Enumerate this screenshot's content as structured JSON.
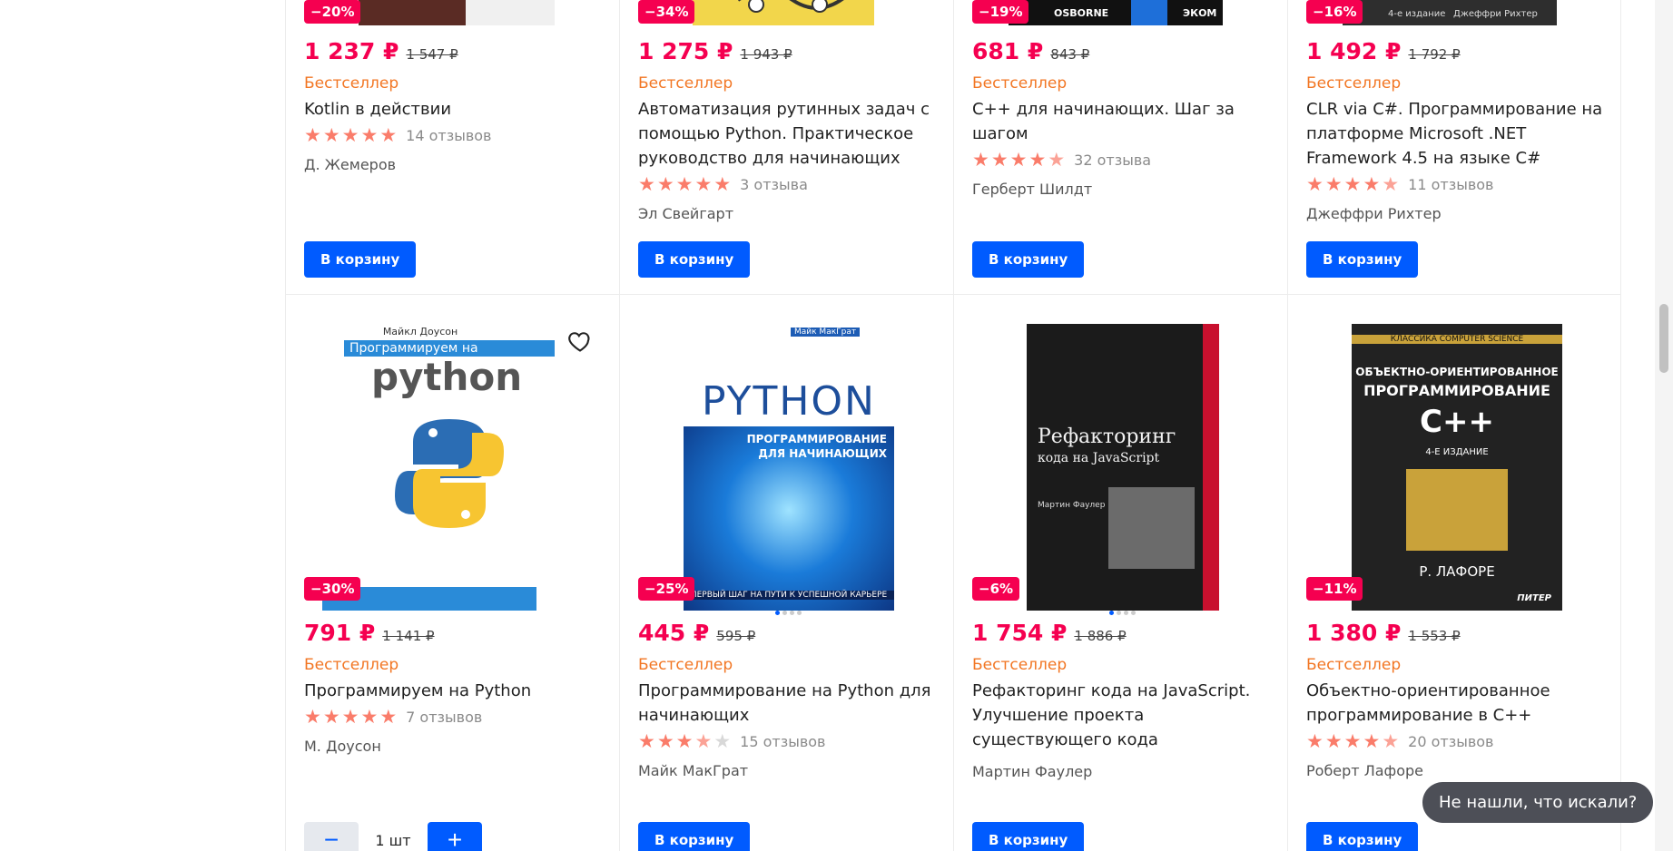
{
  "currency": "₽",
  "bestseller_label": "Бестселлер",
  "cart_label": "В корзину",
  "help_button": "Не нашли, что искали?",
  "row1": [
    {
      "discount": "−20%",
      "price": "1 237 ₽",
      "old_price": "1 547 ₽",
      "title": "Kotlin в действии",
      "stars": [
        1,
        1,
        1,
        1,
        1
      ],
      "reviews": "14 отзывов",
      "author": "Д. Жемеров"
    },
    {
      "discount": "−34%",
      "price": "1 275 ₽",
      "old_price": "1 943 ₽",
      "title": "Автоматизация рутинных задач с помощью Python. Практическое руководство для начинающих",
      "stars": [
        1,
        1,
        1,
        1,
        1
      ],
      "reviews": "3 отзыва",
      "author": "Эл Свейгарт"
    },
    {
      "discount": "−19%",
      "price": "681 ₽",
      "old_price": "843 ₽",
      "title": "C++ для начинающих. Шаг за шагом",
      "stars": [
        1,
        1,
        1,
        1,
        0.5
      ],
      "reviews": "32 отзыва",
      "author": "Герберт Шилдт",
      "cover_text": "OSBORNE",
      "cover_text2": "ЭКОМ"
    },
    {
      "discount": "−16%",
      "price": "1 492 ₽",
      "old_price": "1 792 ₽",
      "title": "CLR via C#. Программирование на платформе Microsoft .NET Framework 4.5 на языке C#",
      "stars": [
        1,
        1,
        1,
        1,
        0.5
      ],
      "reviews": "11 отзывов",
      "author": "Джеффри Рихтер",
      "cover_text": "4-е издание",
      "cover_text2": "Джеффри Рихтер"
    }
  ],
  "row2": [
    {
      "discount": "−30%",
      "price": "791 ₽",
      "old_price": "1 141 ₽",
      "title": "Программируем на Python",
      "stars": [
        1,
        1,
        1,
        1,
        1
      ],
      "reviews": "7 отзывов",
      "author": "М. Доусон",
      "qty": "1 шт",
      "cover": {
        "author": "Майкл Доусон",
        "line1": "Программируем на",
        "line2": "python"
      }
    },
    {
      "discount": "−25%",
      "price": "445 ₽",
      "old_price": "595 ₽",
      "title": "Программирование на Python для начинающих",
      "stars": [
        1,
        1,
        1,
        0.5,
        0
      ],
      "reviews": "15 отзывов",
      "author": "Майк МакГрат",
      "cover": {
        "author": "Майк МакГрат",
        "line1": "PYTHON",
        "line2": "ПРОГРАММИРОВАНИЕ",
        "line3": "ДЛЯ НАЧИНАЮЩИХ",
        "footer": "ПЕРВЫЙ ШАГ НА ПУТИ К УСПЕШНОЙ КАРЬЕРЕ"
      }
    },
    {
      "discount": "−6%",
      "price": "1 754 ₽",
      "old_price": "1 886 ₽",
      "title": "Рефакторинг кода на JavaScript. Улучшение проекта существующего кода",
      "stars": [],
      "reviews": "",
      "author": "Мартин Фаулер",
      "cover": {
        "line1": "Рефакторинг",
        "line2": "кода на JavaScript",
        "author": "Мартин Фаулер"
      }
    },
    {
      "discount": "−11%",
      "price": "1 380 ₽",
      "old_price": "1 553 ₽",
      "title": "Объектно-ориентированное программирование в С++",
      "stars": [
        1,
        1,
        1,
        1,
        0.5
      ],
      "reviews": "20 отзывов",
      "author": "Роберт Лафоре",
      "cover": {
        "series": "КЛАССИКА COMPUTER SCIENCE",
        "line1": "ОБЪЕКТНО-ОРИЕНТИРОВАННОЕ",
        "line2": "ПРОГРАММИРОВАНИЕ",
        "line3": "C++",
        "edition": "4-Е ИЗДАНИЕ",
        "author": "Р. ЛАФОРЕ",
        "publisher": "ПИТЕР"
      }
    }
  ]
}
